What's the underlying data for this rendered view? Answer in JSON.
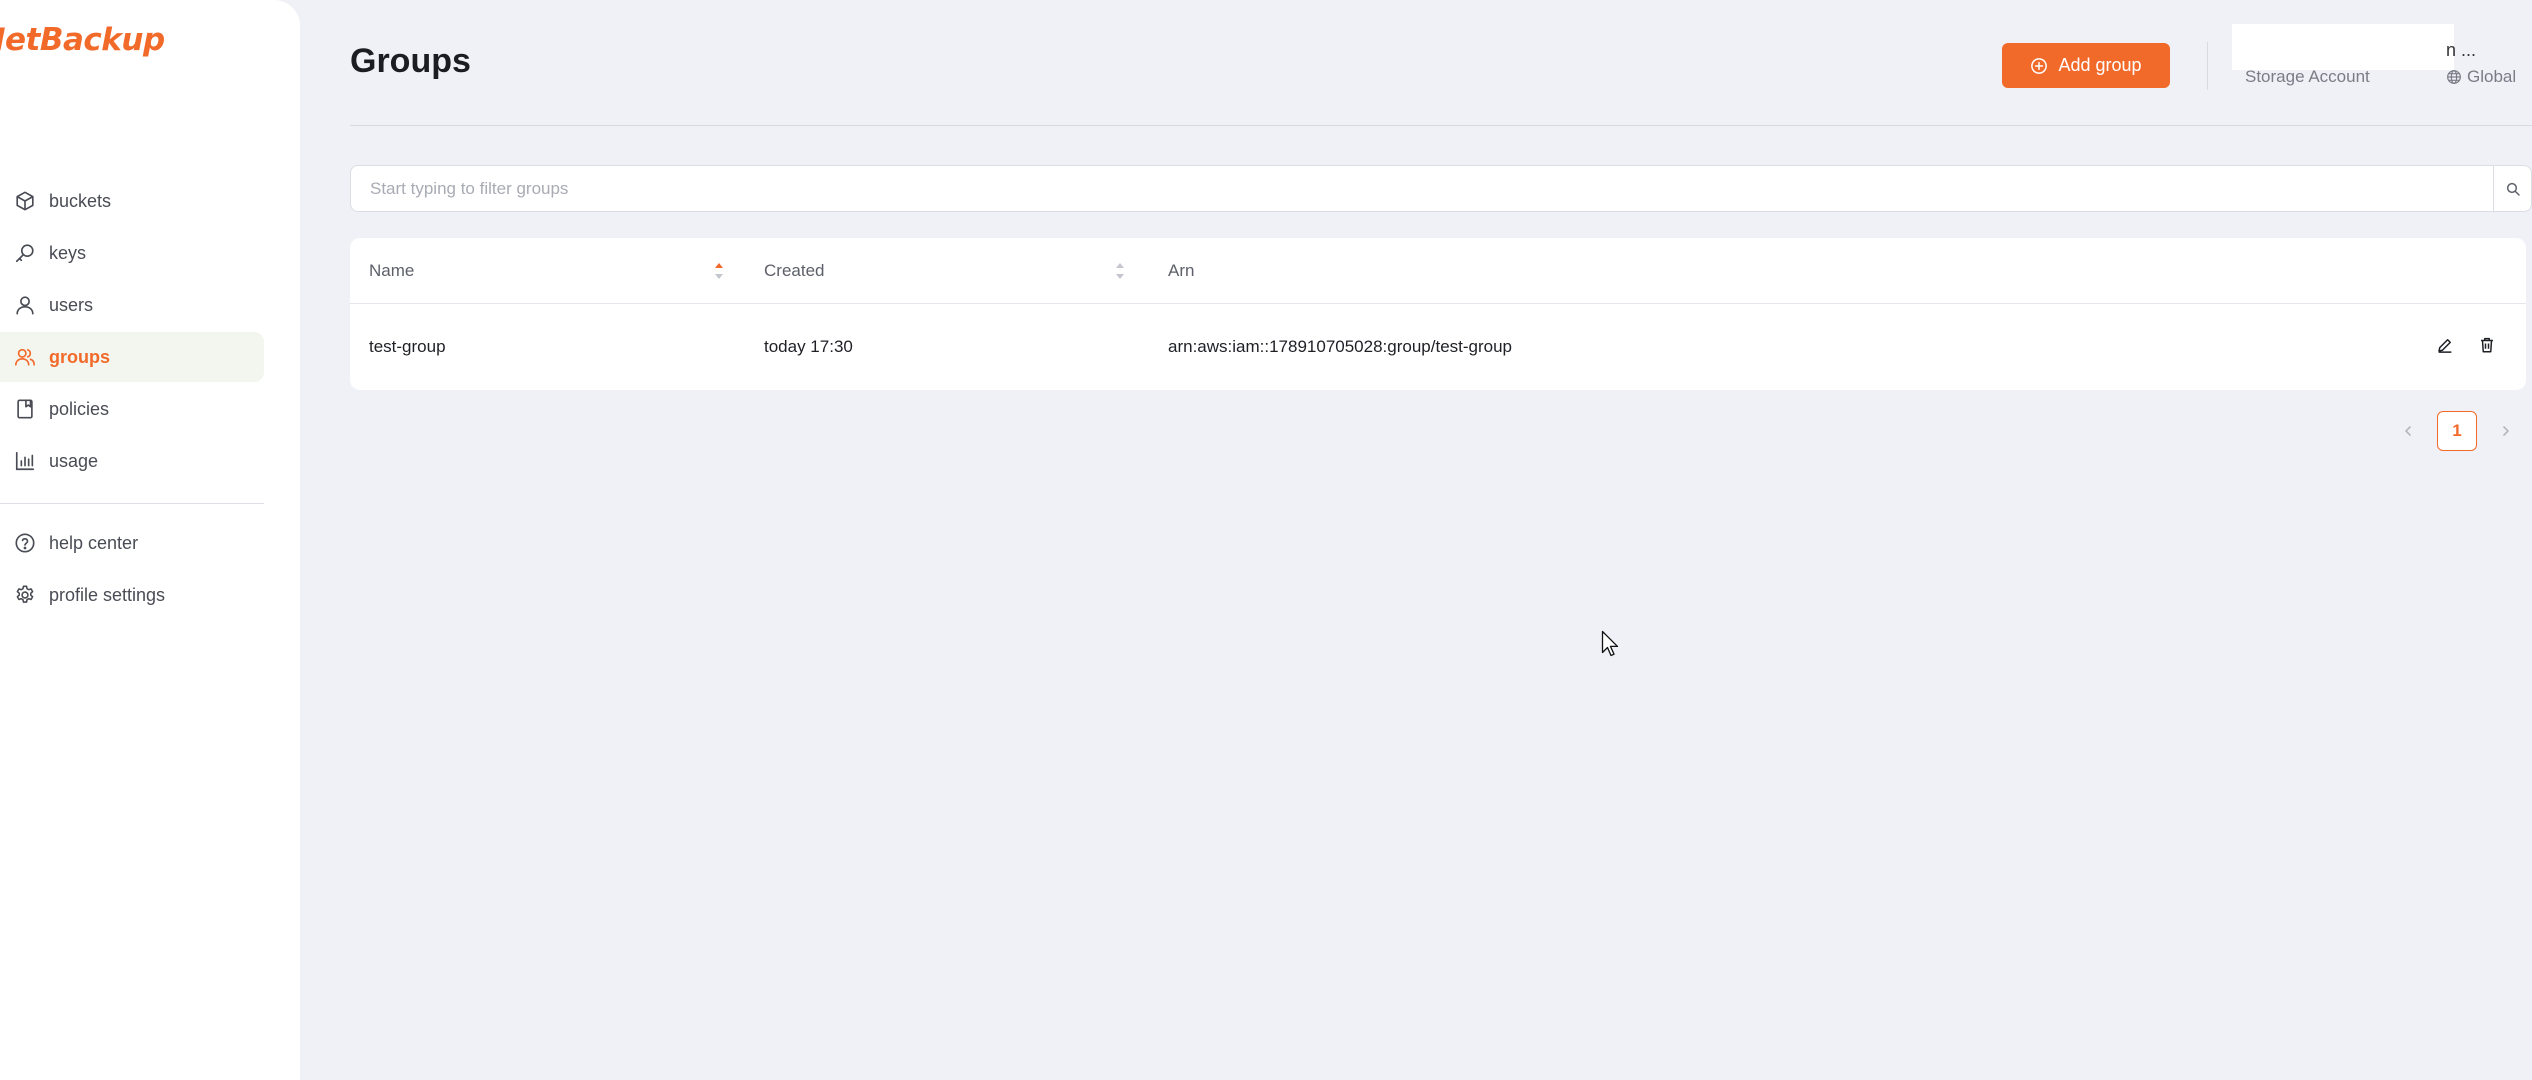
{
  "brand": {
    "logo_text": "JetBackup",
    "accent_color": "#f26a2a"
  },
  "sidebar": {
    "items": [
      {
        "label": "buckets",
        "icon": "cube-icon",
        "active": false
      },
      {
        "label": "keys",
        "icon": "key-icon",
        "active": false
      },
      {
        "label": "users",
        "icon": "user-icon",
        "active": false
      },
      {
        "label": "groups",
        "icon": "users-group-icon",
        "active": true
      },
      {
        "label": "policies",
        "icon": "document-icon",
        "active": false
      },
      {
        "label": "usage",
        "icon": "bar-chart-icon",
        "active": false
      }
    ],
    "secondary": [
      {
        "label": "help center",
        "icon": "help-circle-icon"
      },
      {
        "label": "profile settings",
        "icon": "gear-icon"
      }
    ]
  },
  "header": {
    "title": "Groups",
    "add_button_label": "Add group",
    "account_name": "n ...",
    "account_type": "Storage Account",
    "region": "Global"
  },
  "search": {
    "placeholder": "Start typing to filter groups",
    "value": ""
  },
  "table": {
    "columns": [
      "Name",
      "Created",
      "Arn"
    ],
    "rows": [
      {
        "name": "test-group",
        "created": "today 17:30",
        "arn": "arn:aws:iam::178910705028:group/test-group"
      }
    ]
  },
  "pagination": {
    "current_page": "1"
  }
}
